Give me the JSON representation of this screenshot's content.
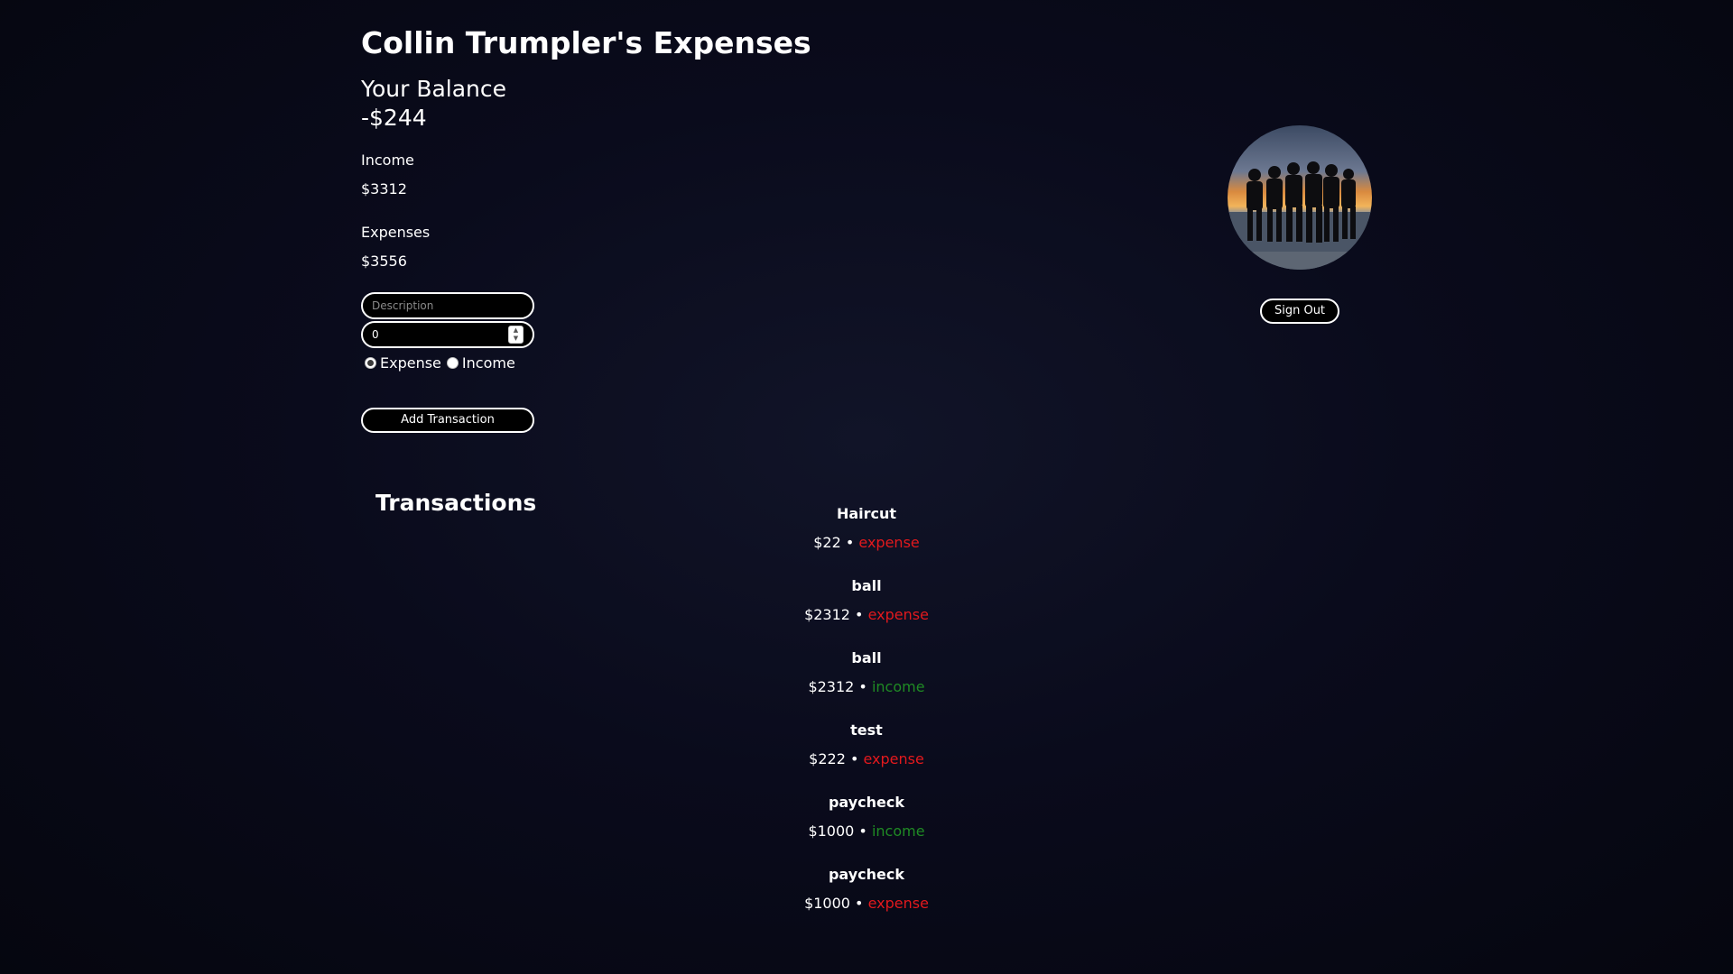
{
  "header": {
    "title": "Collin Trumpler's Expenses",
    "balance_label": "Your Balance",
    "balance_value": "-$244"
  },
  "summary": {
    "income_label": "Income",
    "income_value": "$3312",
    "expenses_label": "Expenses",
    "expenses_value": "$3556"
  },
  "form": {
    "description_placeholder": "Description",
    "amount_value": "0",
    "radio_expense_label": "Expense",
    "radio_income_label": "Income",
    "selected_type": "Expense",
    "add_button_label": "Add Transaction"
  },
  "transactions": {
    "heading": "Transactions",
    "separator": " • ",
    "items": [
      {
        "description": "Haircut",
        "amount": "$22",
        "type": "expense"
      },
      {
        "description": "ball",
        "amount": "$2312",
        "type": "expense"
      },
      {
        "description": "ball",
        "amount": "$2312",
        "type": "income"
      },
      {
        "description": "test",
        "amount": "$222",
        "type": "expense"
      },
      {
        "description": "paycheck",
        "amount": "$1000",
        "type": "income"
      },
      {
        "description": "paycheck",
        "amount": "$1000",
        "type": "expense"
      }
    ]
  },
  "profile": {
    "avatar_icon": "group-silhouette-sunset-photo",
    "signout_label": "Sign Out"
  },
  "colors": {
    "background": "#0a0b1c",
    "expense": "#e3191d",
    "income": "#1f8a24",
    "text": "#ffffff"
  }
}
